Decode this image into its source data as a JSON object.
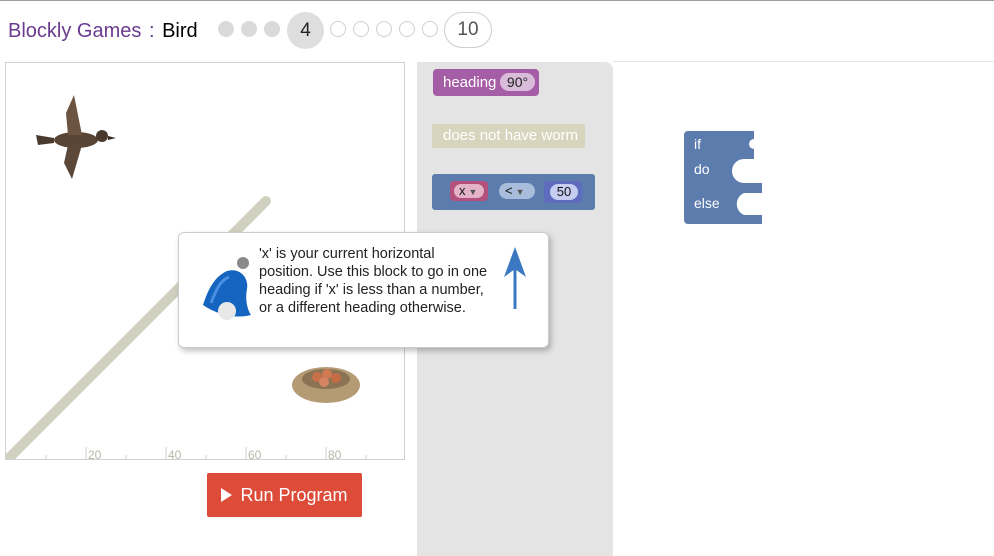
{
  "header": {
    "game_name": "Blockly Games",
    "separator": ":",
    "level_name": "Bird",
    "current_level": "4",
    "last_level": "10"
  },
  "visualization": {
    "x_ticks": [
      "20",
      "40",
      "60",
      "80"
    ]
  },
  "run_button": {
    "label": "Run Program"
  },
  "toolbox": {
    "heading_block": {
      "label": "heading",
      "value": "90°"
    },
    "worm_block": {
      "label": "does not have worm"
    },
    "compare_block": {
      "left": "x",
      "operator": "<",
      "right": "50"
    }
  },
  "workspace": {
    "if_block": {
      "if_label": "if",
      "do_label": "do",
      "else_label": "else"
    }
  },
  "tooltip": {
    "text": "'x' is your current horizontal position. Use this block to go in one heading if 'x' is less than a number, or a different heading otherwise."
  },
  "colors": {
    "title_purple": "#6a3b8f",
    "run_red": "#dd4b39",
    "heading_purple": "#a55ea6",
    "logic_blue": "#5b7cad",
    "arrow_blue": "#3a78c2"
  }
}
